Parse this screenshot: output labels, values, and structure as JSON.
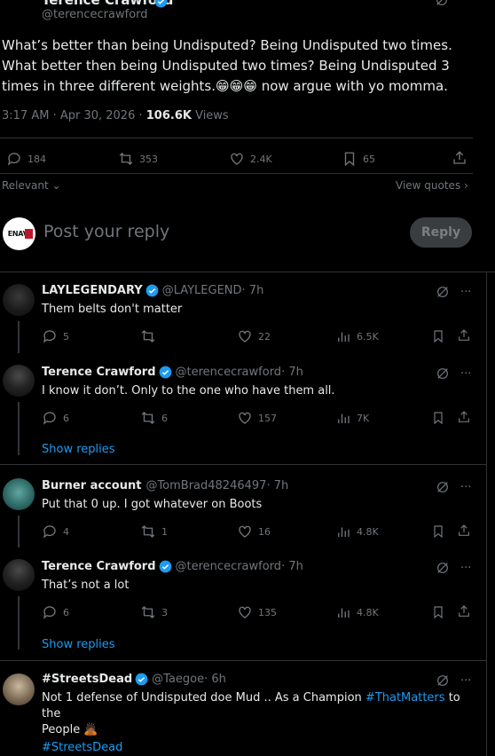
{
  "tweet": {
    "author_name": "Terence Crawford",
    "handle": "@terencecrawford",
    "text_plain_1": "What’s better than being Undisputed? Being Undisputed two times. What better then being Undisputed two times? Being Undisputed 3 times in three different weights.",
    "emojis": "😁😁😁",
    "text_plain_2": " now argue with yo momma.",
    "time": "3:17 AM · Apr 30, 2026 · ",
    "views_count": "106.6K",
    "views_label": " Views",
    "replies": "184",
    "retweets": "353",
    "likes": "2.4K",
    "bookmarks": "65"
  },
  "filter": {
    "relevant": "Relevant",
    "view_quotes": "View quotes"
  },
  "composer": {
    "placeholder": "Post your reply",
    "reply_button": "Reply",
    "avatar_text": "ENAVI"
  },
  "replies": [
    {
      "name": "LAYLEGENDARY",
      "handle": "@LAYLEGEND",
      "time": " · 7h",
      "text": "Them belts don't matter",
      "replies": "5",
      "retweets": "",
      "likes": "22",
      "views": "6.5K"
    },
    {
      "name": "Terence Crawford",
      "handle": "@terencecrawford",
      "time": " · 7h",
      "text": "I know it don’t. Only to the one who have them all.",
      "replies": "6",
      "retweets": "6",
      "likes": "157",
      "views": "7K",
      "show_replies": "Show replies"
    },
    {
      "name": "Burner account",
      "handle": "@TomBrad48246497",
      "time": " · 7h",
      "text": "Put that 0 up. I got whatever on Boots",
      "replies": "4",
      "retweets": "1",
      "likes": "16",
      "views": "4.8K"
    },
    {
      "name": "Terence Crawford",
      "handle": "@terencecrawford",
      "time": " · 7h",
      "text": "That’s not a lot",
      "replies": "6",
      "retweets": "3",
      "likes": "135",
      "views": "4.8K",
      "show_replies": "Show replies"
    },
    {
      "name": "#StreetsDead",
      "handle": "@Taegoe",
      "time": " · 6h",
      "text_1": "Not 1 defense of Undisputed doe Mud .. As a Champion ",
      "hashtag_1": "#ThatMatters",
      "text_2": " to the",
      "text_3": "People ",
      "emoji": "🙇🏾",
      "hashtag_2": "#StreetsDead"
    }
  ],
  "colors": {
    "accent": "#1d9bf0",
    "background": "#000000",
    "muted": "#71767b"
  }
}
